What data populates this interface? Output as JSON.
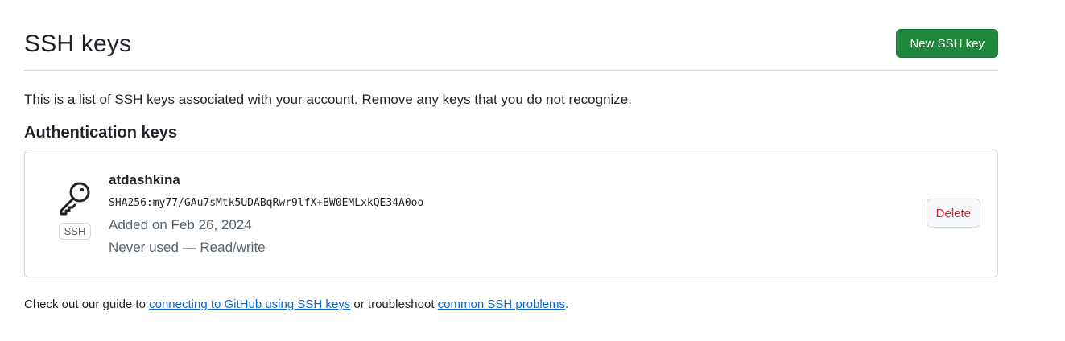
{
  "header": {
    "title": "SSH keys",
    "new_key_label": "New SSH key"
  },
  "intro_text": "This is a list of SSH keys associated with your account. Remove any keys that you do not recognize.",
  "section_title": "Authentication keys",
  "keys": [
    {
      "title": "atdashkina",
      "fingerprint": "SHA256:my77/GAu7sMtk5UDABqRwr9lfX+BW0EMLxkQE34A0oo",
      "added": "Added on Feb 26, 2024",
      "usage": "Never used — Read/write",
      "badge": "SSH",
      "icon": "key-icon",
      "delete_label": "Delete"
    }
  ],
  "footer": {
    "prefix": "Check out our guide to ",
    "link1": "connecting to GitHub using SSH keys",
    "middle": " or troubleshoot ",
    "link2": "common SSH problems",
    "suffix": "."
  },
  "colors": {
    "primary_button": "#1f883d",
    "danger_text": "#d1242f",
    "link": "#0969da",
    "muted_text": "#59636e",
    "border": "#d0d7de"
  }
}
